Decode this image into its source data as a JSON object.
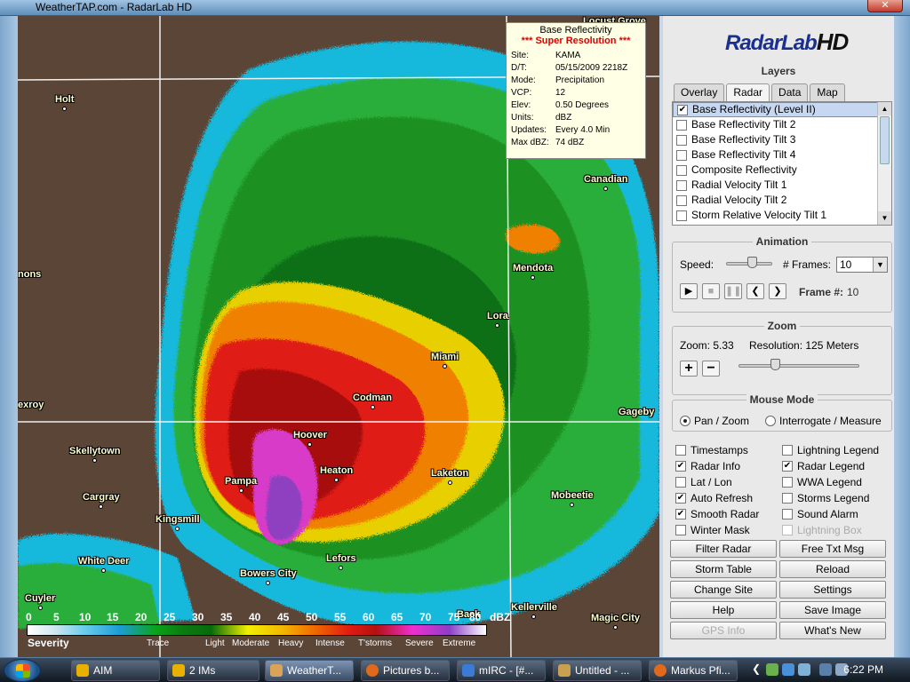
{
  "window": {
    "title": "WeatherTAP.com - RadarLab HD"
  },
  "map": {
    "info": {
      "title": "Base Reflectivity",
      "subtitle": "*** Super Resolution ***",
      "rows": [
        {
          "k": "Site:",
          "v": "KAMA"
        },
        {
          "k": "D/T:",
          "v": "05/15/2009 2218Z"
        },
        {
          "k": "Mode:",
          "v": "Precipitation"
        },
        {
          "k": "VCP:",
          "v": "12"
        },
        {
          "k": "Elev:",
          "v": "0.50 Degrees"
        },
        {
          "k": "Units:",
          "v": "dBZ"
        },
        {
          "k": "Updates:",
          "v": "Every 4.0 Min"
        },
        {
          "k": "Max dBZ:",
          "v": "74 dBZ"
        }
      ]
    },
    "cities": [
      "Holt",
      "Canadian",
      "Mendota",
      "Lora",
      "Miami",
      "Codman",
      "Hoover",
      "Heaton",
      "Laketon",
      "Pampa",
      "Kingsmill",
      "Lefors",
      "Bowers City",
      "Mobeetie",
      "Skellytown",
      "Cargray",
      "White Deer",
      "Cuyler",
      "Kellerville",
      "Magic City",
      "Back",
      "Gageby",
      "Locust Grove",
      "nons",
      "exroy"
    ],
    "legend": {
      "ticks": [
        "0",
        "5",
        "10",
        "15",
        "20",
        "25",
        "30",
        "35",
        "40",
        "45",
        "50",
        "55",
        "60",
        "65",
        "70",
        "75",
        "80",
        "dBZ"
      ],
      "severity_label": "Severity",
      "categories": [
        "Trace",
        "Light",
        "Moderate",
        "Heavy",
        "Intense",
        "T'storms",
        "Severe",
        "Extreme"
      ]
    }
  },
  "panel": {
    "logo_main": "RadarLab",
    "logo_hd": "HD",
    "layers_title": "Layers",
    "tabs": [
      "Overlay",
      "Radar",
      "Data",
      "Map"
    ],
    "active_tab": "Radar",
    "layers": [
      {
        "label": "Base Reflectivity (Level II)",
        "checked": true
      },
      {
        "label": "Base Reflectivity Tilt 2",
        "checked": false
      },
      {
        "label": "Base Reflectivity Tilt 3",
        "checked": false
      },
      {
        "label": "Base Reflectivity Tilt 4",
        "checked": false
      },
      {
        "label": "Composite Reflectivity",
        "checked": false
      },
      {
        "label": "Radial Velocity Tilt 1",
        "checked": false
      },
      {
        "label": "Radial Velocity Tilt 2",
        "checked": false
      },
      {
        "label": "Storm Relative Velocity Tilt 1",
        "checked": false
      }
    ],
    "animation": {
      "title": "Animation",
      "speed_label": "Speed:",
      "frames_label": "# Frames:",
      "frames_value": "10",
      "frame_num_label": "Frame #:",
      "frame_num_value": "10",
      "speed_level": 0.55
    },
    "zoom": {
      "title": "Zoom",
      "zoom_text": "Zoom:  5.33",
      "resolution_text": "Resolution:  125 Meters",
      "zoom_level": 0.3
    },
    "mouse_mode": {
      "title": "Mouse Mode",
      "pan": "Pan / Zoom",
      "interrogate": "Interrogate / Measure"
    },
    "options_left": [
      {
        "label": "Timestamps",
        "checked": false
      },
      {
        "label": "Radar Info",
        "checked": true
      },
      {
        "label": "Lat / Lon",
        "checked": false
      },
      {
        "label": "Auto Refresh",
        "checked": true
      },
      {
        "label": "Smooth Radar",
        "checked": true
      },
      {
        "label": "Winter Mask",
        "checked": false
      }
    ],
    "options_right": [
      {
        "label": "Lightning Legend",
        "checked": false
      },
      {
        "label": "Radar Legend",
        "checked": true
      },
      {
        "label": "WWA Legend",
        "checked": false
      },
      {
        "label": "Storms Legend",
        "checked": false
      },
      {
        "label": "Sound Alarm",
        "checked": false
      },
      {
        "label": "Lightning Box",
        "checked": false,
        "disabled": true
      }
    ],
    "buttons": [
      {
        "label": "Filter Radar"
      },
      {
        "label": "Free Txt Msg"
      },
      {
        "label": "Storm Table"
      },
      {
        "label": "Reload"
      },
      {
        "label": "Change Site"
      },
      {
        "label": "Settings"
      },
      {
        "label": "Help"
      },
      {
        "label": "Save Image"
      },
      {
        "label": "GPS Info",
        "disabled": true
      },
      {
        "label": "What's New"
      }
    ]
  },
  "taskbar": {
    "tasks": [
      "AIM",
      "2 IMs",
      "WeatherT...",
      "Pictures b...",
      "mIRC - [#...",
      "Untitled - ...",
      "Markus Pfi..."
    ],
    "clock": "6:22 PM"
  },
  "colors": {
    "map_ground": "#5b4537",
    "reflectivity_light": "#1d9dd6",
    "reflectivity_moderate": "#0aa318",
    "reflectivity_heavy": "#f2b300",
    "reflectivity_intense": "#e21d11",
    "reflectivity_extreme": "#ef2fd1"
  }
}
